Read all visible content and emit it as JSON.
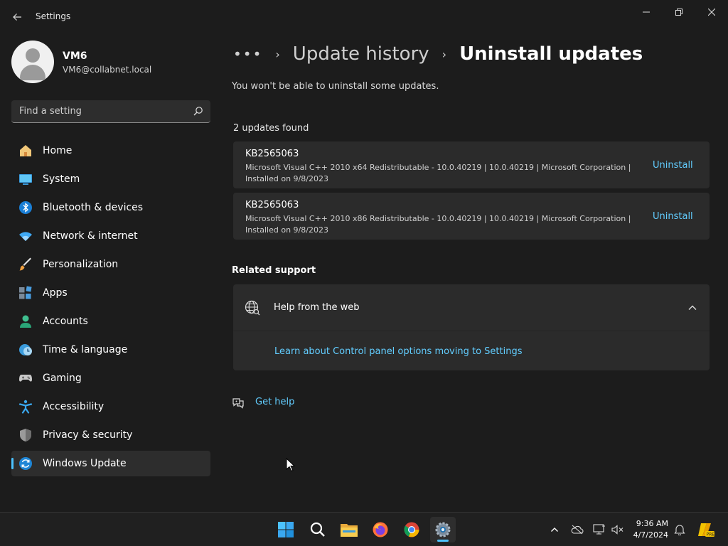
{
  "window": {
    "title": "Settings"
  },
  "profile": {
    "name": "VM6",
    "email": "VM6@collabnet.local"
  },
  "search": {
    "placeholder": "Find a setting"
  },
  "nav": {
    "items": [
      {
        "label": "Home",
        "icon": "home-icon"
      },
      {
        "label": "System",
        "icon": "system-icon"
      },
      {
        "label": "Bluetooth & devices",
        "icon": "bluetooth-icon"
      },
      {
        "label": "Network & internet",
        "icon": "wifi-icon"
      },
      {
        "label": "Personalization",
        "icon": "brush-icon"
      },
      {
        "label": "Apps",
        "icon": "apps-icon"
      },
      {
        "label": "Accounts",
        "icon": "accounts-icon"
      },
      {
        "label": "Time & language",
        "icon": "time-language-icon"
      },
      {
        "label": "Gaming",
        "icon": "gamepad-icon"
      },
      {
        "label": "Accessibility",
        "icon": "accessibility-icon"
      },
      {
        "label": "Privacy & security",
        "icon": "shield-icon"
      },
      {
        "label": "Windows Update",
        "icon": "windows-update-icon",
        "selected": true
      }
    ]
  },
  "breadcrumb": {
    "more": "•••",
    "parent": "Update history",
    "current": "Uninstall updates"
  },
  "main": {
    "subtitle": "You won't be able to uninstall some updates.",
    "count": "2 updates found",
    "updates": [
      {
        "kb": "KB2565063",
        "detail": "Microsoft Visual C++ 2010  x64 Redistributable - 10.0.40219   |   10.0.40219   |   Microsoft Corporation   |   Installed on 9/8/2023",
        "action": "Uninstall"
      },
      {
        "kb": "KB2565063",
        "detail": "Microsoft Visual C++ 2010  x86 Redistributable - 10.0.40219   |   10.0.40219   |   Microsoft Corporation   |   Installed on 9/8/2023",
        "action": "Uninstall"
      }
    ]
  },
  "related": {
    "title": "Related support",
    "help_title": "Help from the web",
    "help_link": "Learn about Control panel options moving to Settings",
    "get_help": "Get help"
  },
  "taskbar": {
    "time": "9:36 AM",
    "date": "4/7/2024",
    "apps": [
      "start-icon",
      "search-icon",
      "file-explorer-icon",
      "firefox-icon",
      "chrome-icon",
      "settings-icon"
    ]
  },
  "colors": {
    "accent": "#4cc2ff",
    "link": "#62cdff",
    "background": "#1c1c1c",
    "card": "#2b2b2b"
  }
}
